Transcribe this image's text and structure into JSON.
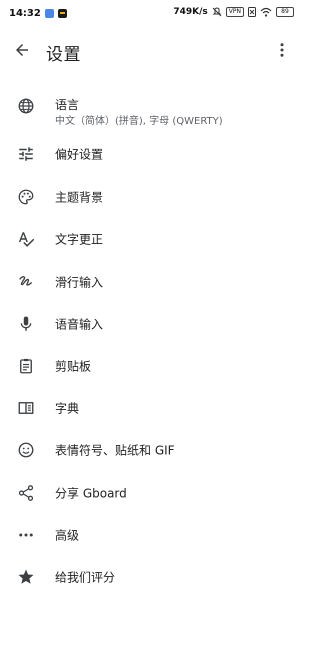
{
  "status_bar": {
    "time": "14:32",
    "net_speed": "749K/s",
    "vpn_label": "VPN",
    "battery_level": "89"
  },
  "app_bar": {
    "title": "设置"
  },
  "menu": [
    {
      "id": "language",
      "icon": "globe-icon",
      "label": "语言",
      "sub": "中文（简体）(拼音), 字母 (QWERTY)"
    },
    {
      "id": "preferences",
      "icon": "tune-icon",
      "label": "偏好设置"
    },
    {
      "id": "theme",
      "icon": "palette-icon",
      "label": "主题背景"
    },
    {
      "id": "text-correction",
      "icon": "spellcheck-icon",
      "label": "文字更正"
    },
    {
      "id": "glide-typing",
      "icon": "gesture-icon",
      "label": "滑行输入"
    },
    {
      "id": "voice-typing",
      "icon": "mic-icon",
      "label": "语音输入"
    },
    {
      "id": "clipboard",
      "icon": "clipboard-icon",
      "label": "剪贴板"
    },
    {
      "id": "dictionary",
      "icon": "book-icon",
      "label": "字典"
    },
    {
      "id": "emoji",
      "icon": "smiley-icon",
      "label": "表情符号、贴纸和 GIF"
    },
    {
      "id": "share",
      "icon": "share-icon",
      "label": "分享 Gboard"
    },
    {
      "id": "advanced",
      "icon": "more-horiz-icon",
      "label": "高级"
    },
    {
      "id": "rate",
      "icon": "star-icon",
      "label": "给我们评分"
    }
  ]
}
